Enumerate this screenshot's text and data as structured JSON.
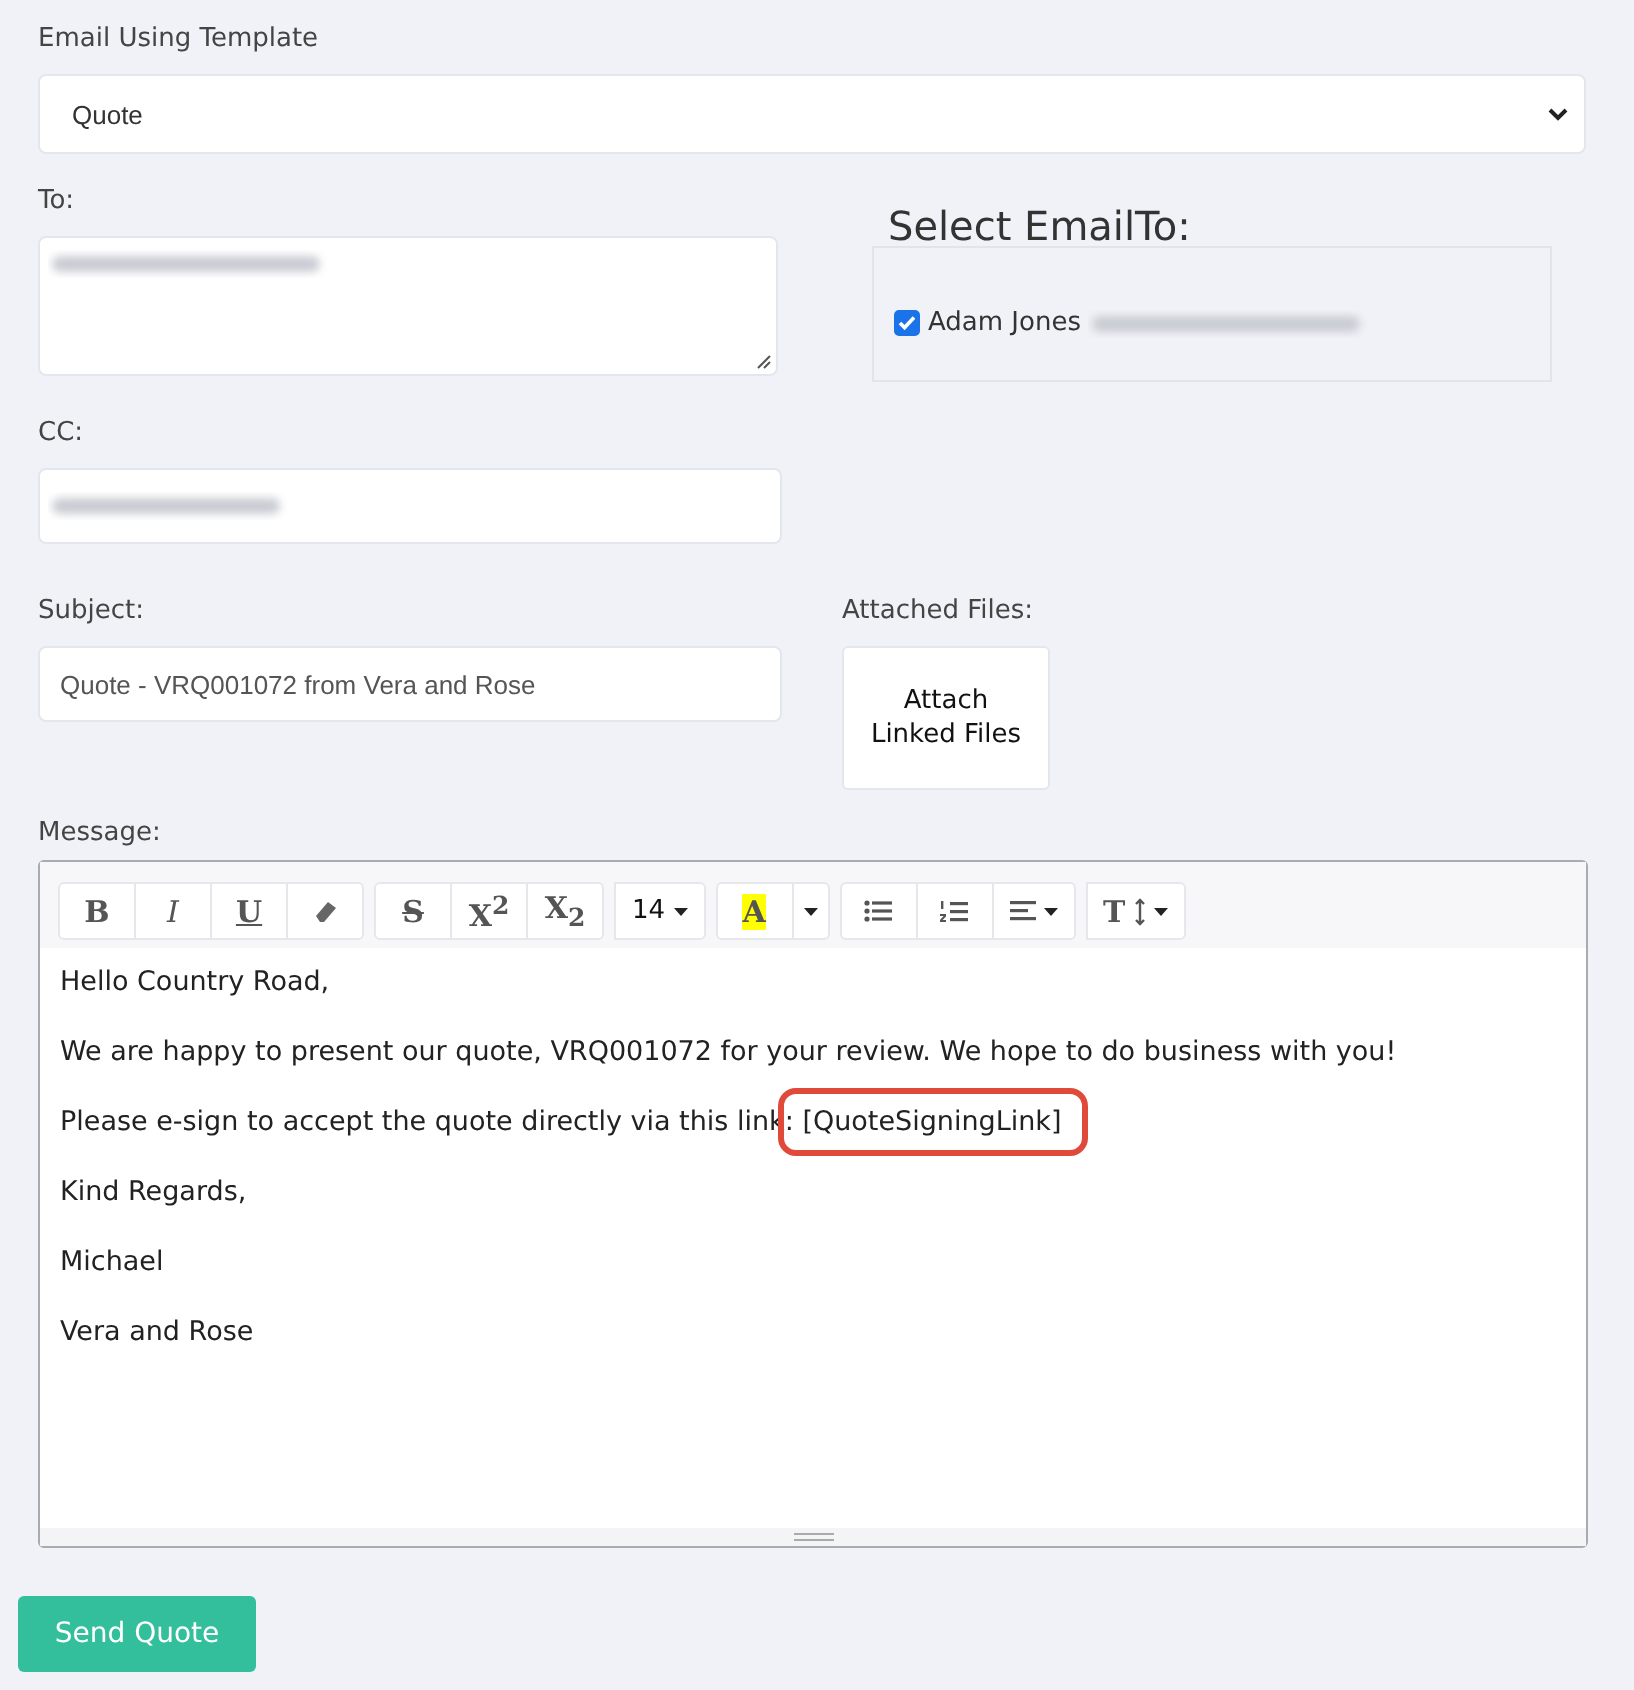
{
  "template": {
    "label": "Email Using Template",
    "value": "Quote"
  },
  "to": {
    "label": "To:"
  },
  "select_email_to": {
    "title": "Select EmailTo:",
    "recipients": [
      {
        "name": "Adam Jones",
        "checked": true
      }
    ]
  },
  "cc": {
    "label": "CC:"
  },
  "subject": {
    "label": "Subject:",
    "value": "Quote - VRQ001072 from Vera and Rose"
  },
  "attached_files": {
    "label": "Attached Files:",
    "button": "Attach Linked Files"
  },
  "message": {
    "label": "Message:",
    "toolbar": [
      [
        {
          "kind": "text",
          "label": "B"
        },
        {
          "kind": "text",
          "label": "I"
        },
        {
          "kind": "text",
          "label": "U"
        },
        {
          "kind": "icon"
        }
      ],
      [
        {
          "kind": "text",
          "label": "S"
        },
        {
          "kind": "text",
          "label": "X$^{2}$"
        },
        {
          "kind": "text",
          "label": "X$_{2}$"
        }
      ],
      [
        {
          "kind": "text",
          "label": "14"
        }
      ],
      [
        {
          "kind": "text",
          "label": "A"
        },
        {
          "kind": "caret"
        }
      ],
      [
        {
          "kind": "icon"
        },
        {
          "kind": "icon"
        },
        {
          "kind": "icon"
        }
      ],
      [
        {
          "kind": "text",
          "label": "T"
        }
      ]
    ],
    "paragraphs": [
      {
        "text": "Hello Country Road,"
      },
      {
        "text": "We are happy to present our quote, VRQ001072 for your review. We hope to do business with you!"
      },
      {
        "text": "Please e-sign to accept the quote directly via this link: ",
        "highlight": "[QuoteSigningLink]"
      },
      {
        "text": "Kind Regards,"
      },
      {
        "text": "Michael"
      },
      {
        "text": "Vera and Rose"
      }
    ]
  },
  "send_button": "Send Quote"
}
